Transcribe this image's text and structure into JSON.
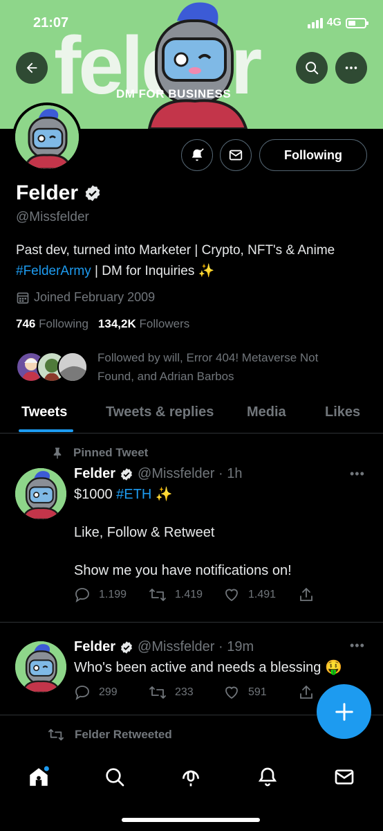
{
  "status_bar": {
    "time": "21:07",
    "network": "4G"
  },
  "banner": {
    "wordmark": "felder",
    "subtitle": "DM FOR BUSINESS"
  },
  "profile": {
    "display_name": "Felder",
    "handle": "@Missfelder",
    "bio_prefix": "Past dev, turned into Marketer | Crypto, NFT's & Anime ",
    "bio_hashtag": "#FelderArmy",
    "bio_suffix": " | DM for Inquiries ✨",
    "joined": "Joined February 2009",
    "following_count": "746",
    "following_label": "Following",
    "followers_count": "134,2K",
    "followers_label": "Followers",
    "followed_by": "Followed by will, Error 404! Metaverse Not Found, and Adrian Barbos",
    "following_button": "Following"
  },
  "tabs": [
    {
      "label": "Tweets",
      "active": true
    },
    {
      "label": "Tweets & replies",
      "active": false
    },
    {
      "label": "Media",
      "active": false
    },
    {
      "label": "Likes",
      "active": false
    }
  ],
  "tweets": [
    {
      "pinned_label": "Pinned Tweet",
      "name": "Felder",
      "meta": "@Missfelder · 1h",
      "line1_prefix": "$1000 ",
      "line1_hashtag": "#ETH",
      "line1_suffix": " ✨",
      "line2": "Like, Follow & Retweet",
      "line3": "Show me you have notifications on!",
      "replies": "1.199",
      "retweets": "1.419",
      "likes": "1.491"
    },
    {
      "name": "Felder",
      "meta": "@Missfelder · 19m",
      "text": "Who's been active and needs a blessing 🤑",
      "replies": "299",
      "retweets": "233",
      "likes": "591"
    }
  ],
  "retweeted_label": "Felder Retweeted",
  "colors": {
    "accent": "#1d9bf0",
    "banner": "#8ed68a",
    "muted": "#71767b"
  },
  "icons": [
    "back-arrow-icon",
    "search-icon",
    "more-icon",
    "bell-icon",
    "mail-icon",
    "verified-icon",
    "calendar-icon",
    "pin-icon",
    "reply-icon",
    "retweet-icon",
    "like-icon",
    "share-icon",
    "compose-icon",
    "home-icon",
    "explore-icon",
    "spaces-icon",
    "notifications-icon",
    "messages-icon"
  ]
}
